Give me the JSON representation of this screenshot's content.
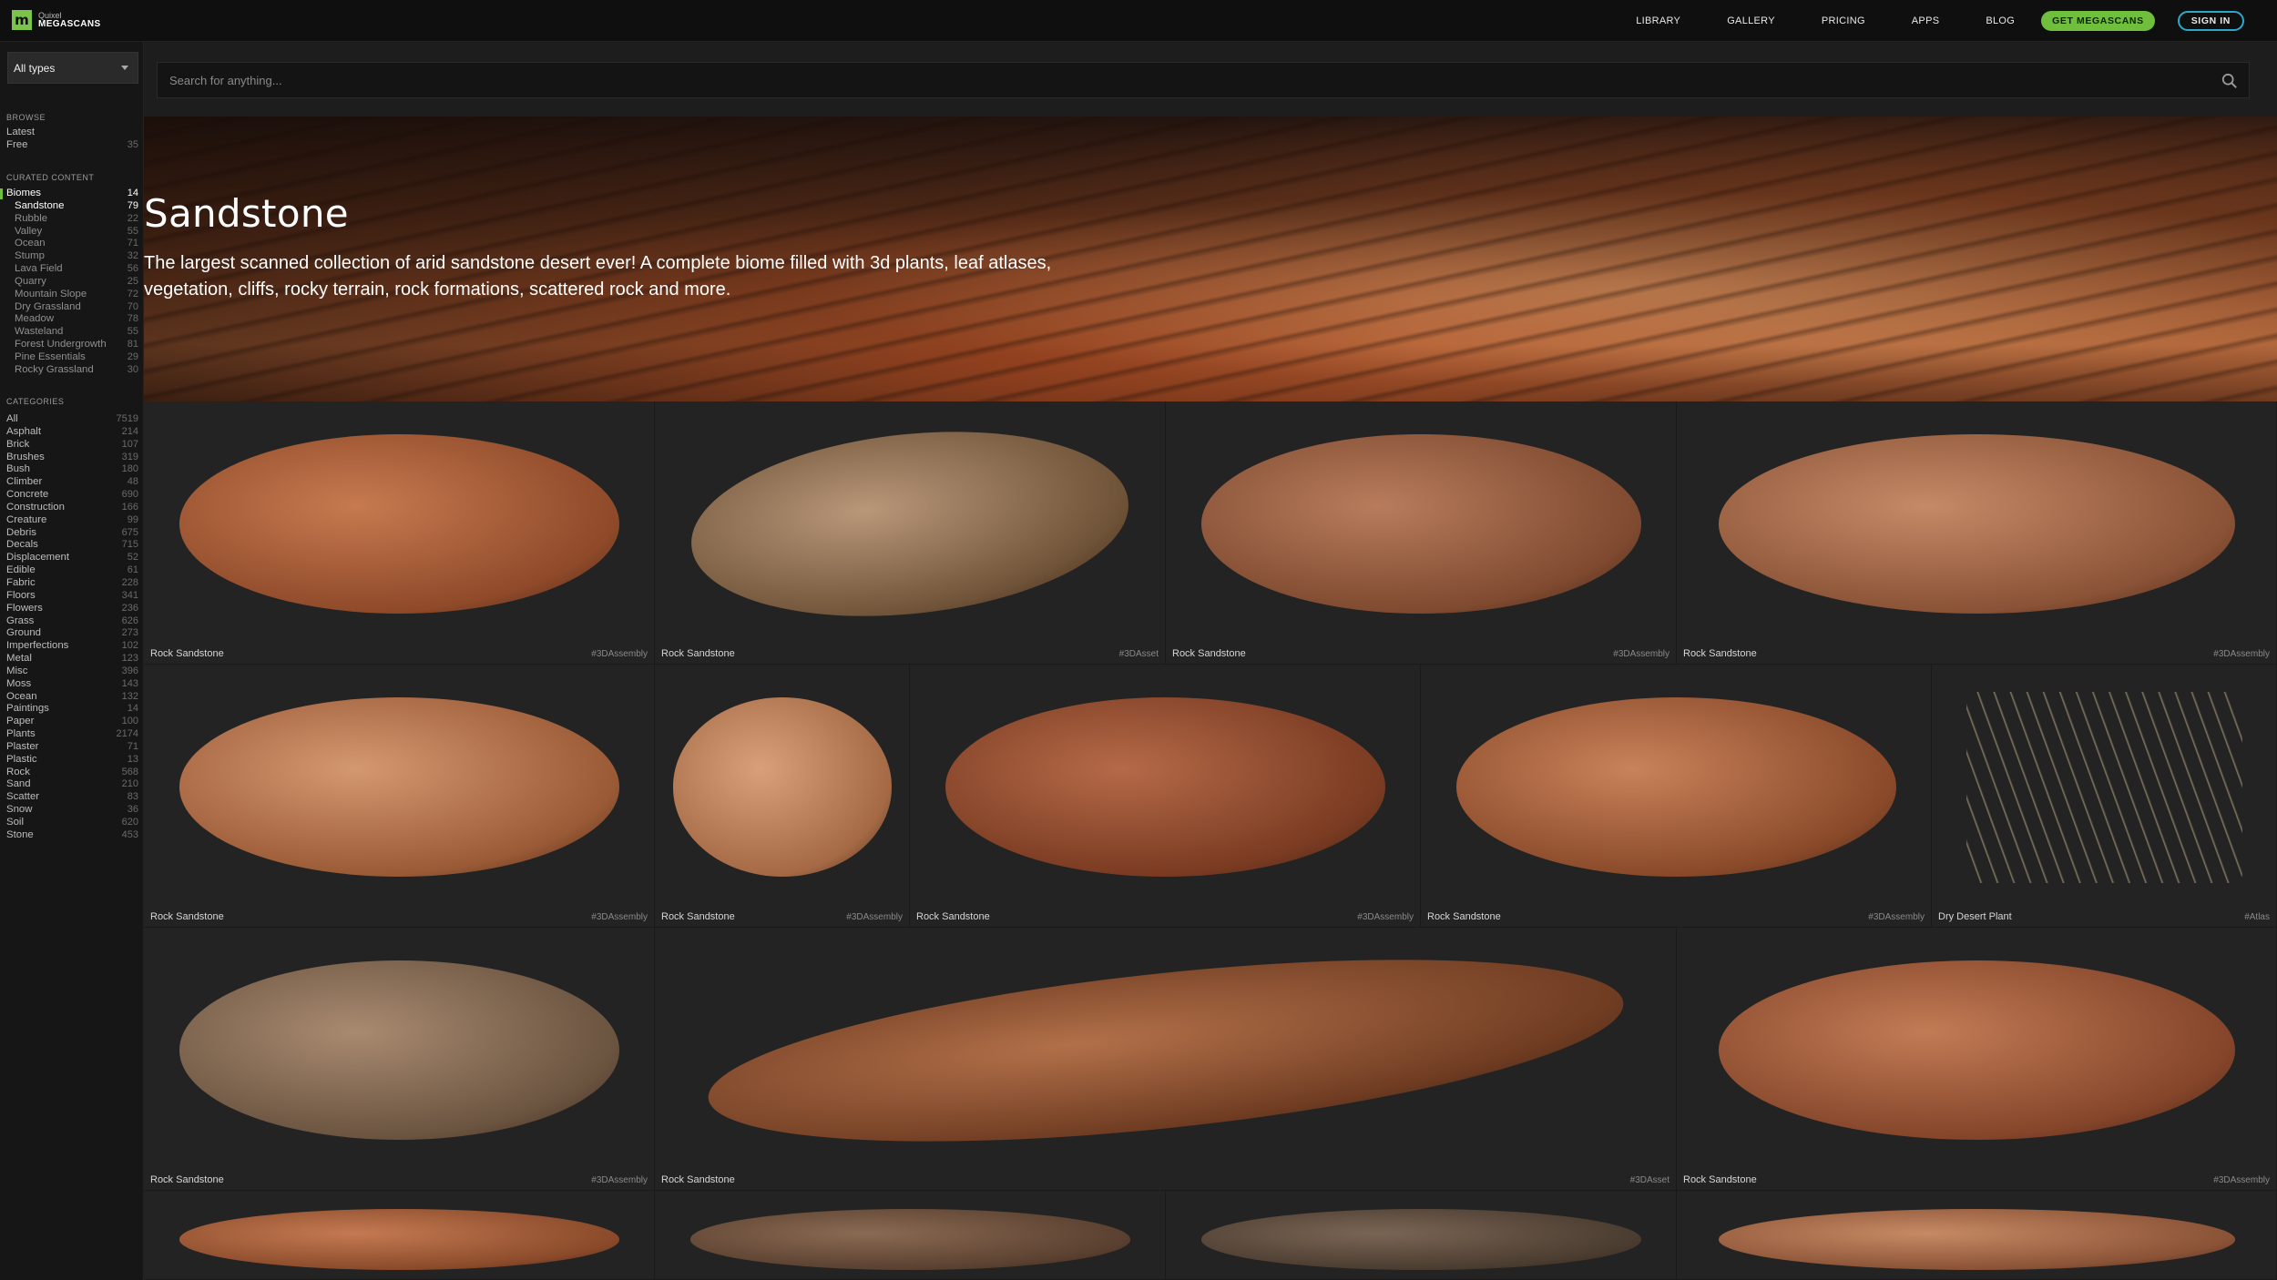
{
  "brand": {
    "mark": "m",
    "line1": "Quixel",
    "line2": "MEGASCANS"
  },
  "nav": {
    "links": [
      "LIBRARY",
      "GALLERY",
      "PRICING",
      "APPS",
      "BLOG"
    ],
    "get_label": "GET MEGASCANS",
    "sign_label": "SIGN IN",
    "accent": "#6fbf3c",
    "sign_border": "#2ca8c9"
  },
  "sidebar": {
    "type_select": "All types",
    "browse_title": "BROWSE",
    "browse": [
      {
        "label": "Latest",
        "count": ""
      },
      {
        "label": "Free",
        "count": "35"
      }
    ],
    "curated_title": "CURATED CONTENT",
    "curated": [
      {
        "label": "Biomes",
        "count": "14",
        "level": "parent-active"
      },
      {
        "label": "Sandstone",
        "count": "79",
        "level": "sub-active"
      },
      {
        "label": "Rubble",
        "count": "22",
        "level": "sub"
      },
      {
        "label": "Valley",
        "count": "55",
        "level": "sub"
      },
      {
        "label": "Ocean",
        "count": "71",
        "level": "sub"
      },
      {
        "label": "Stump",
        "count": "32",
        "level": "sub"
      },
      {
        "label": "Lava Field",
        "count": "56",
        "level": "sub"
      },
      {
        "label": "Quarry",
        "count": "25",
        "level": "sub"
      },
      {
        "label": "Mountain Slope",
        "count": "72",
        "level": "sub"
      },
      {
        "label": "Dry Grassland",
        "count": "70",
        "level": "sub"
      },
      {
        "label": "Meadow",
        "count": "78",
        "level": "sub"
      },
      {
        "label": "Wasteland",
        "count": "55",
        "level": "sub"
      },
      {
        "label": "Forest Undergrowth",
        "count": "81",
        "level": "sub"
      },
      {
        "label": "Pine Essentials",
        "count": "29",
        "level": "sub"
      },
      {
        "label": "Rocky Grassland",
        "count": "30",
        "level": "sub"
      }
    ],
    "categories_title": "CATEGORIES",
    "categories": [
      {
        "label": "All",
        "count": "7519"
      },
      {
        "label": "Asphalt",
        "count": "214"
      },
      {
        "label": "Brick",
        "count": "107"
      },
      {
        "label": "Brushes",
        "count": "319"
      },
      {
        "label": "Bush",
        "count": "180"
      },
      {
        "label": "Climber",
        "count": "48"
      },
      {
        "label": "Concrete",
        "count": "690"
      },
      {
        "label": "Construction",
        "count": "166"
      },
      {
        "label": "Creature",
        "count": "99"
      },
      {
        "label": "Debris",
        "count": "675"
      },
      {
        "label": "Decals",
        "count": "715"
      },
      {
        "label": "Displacement",
        "count": "52"
      },
      {
        "label": "Edible",
        "count": "61"
      },
      {
        "label": "Fabric",
        "count": "228"
      },
      {
        "label": "Floors",
        "count": "341"
      },
      {
        "label": "Flowers",
        "count": "236"
      },
      {
        "label": "Grass",
        "count": "626"
      },
      {
        "label": "Ground",
        "count": "273"
      },
      {
        "label": "Imperfections",
        "count": "102"
      },
      {
        "label": "Metal",
        "count": "123"
      },
      {
        "label": "Misc",
        "count": "396"
      },
      {
        "label": "Moss",
        "count": "143"
      },
      {
        "label": "Ocean",
        "count": "132"
      },
      {
        "label": "Paintings",
        "count": "14"
      },
      {
        "label": "Paper",
        "count": "100"
      },
      {
        "label": "Plants",
        "count": "2174"
      },
      {
        "label": "Plaster",
        "count": "71"
      },
      {
        "label": "Plastic",
        "count": "13"
      },
      {
        "label": "Rock",
        "count": "568"
      },
      {
        "label": "Sand",
        "count": "210"
      },
      {
        "label": "Scatter",
        "count": "83"
      },
      {
        "label": "Snow",
        "count": "36"
      },
      {
        "label": "Soil",
        "count": "620"
      },
      {
        "label": "Stone",
        "count": "453"
      }
    ]
  },
  "search": {
    "placeholder": "Search for anything..."
  },
  "hero": {
    "title": "Sandstone",
    "description": "The largest scanned collection of arid sandstone desert ever! A complete biome filled with 3d plants, leaf atlases, vegetation, cliffs, rocky terrain, rock formations, scattered rock and more."
  },
  "assets": [
    {
      "name": "Rock Sandstone",
      "tag": "#3DAssembly",
      "row": 0
    },
    {
      "name": "Rock Sandstone",
      "tag": "#3DAsset",
      "row": 0
    },
    {
      "name": "Rock Sandstone",
      "tag": "#3DAssembly",
      "row": 0
    },
    {
      "name": "Rock Sandstone",
      "tag": "#3DAssembly",
      "row": 0
    },
    {
      "name": "Rock Sandstone",
      "tag": "#3DAssembly",
      "row": 1
    },
    {
      "name": "Rock Sandstone",
      "tag": "#3DAssembly",
      "row": 1
    },
    {
      "name": "Rock Sandstone",
      "tag": "#3DAssembly",
      "row": 1
    },
    {
      "name": "Rock Sandstone",
      "tag": "#3DAssembly",
      "row": 1
    },
    {
      "name": "Dry Desert Plant",
      "tag": "#Atlas",
      "row": 1
    },
    {
      "name": "Rock Sandstone",
      "tag": "#3DAssembly",
      "row": 2
    },
    {
      "name": "Rock Sandstone",
      "tag": "#3DAsset",
      "row": 2
    },
    {
      "name": "Rock Sandstone",
      "tag": "#3DAssembly",
      "row": 2
    },
    {
      "name": "",
      "tag": "",
      "row": 3
    },
    {
      "name": "",
      "tag": "",
      "row": 3
    },
    {
      "name": "",
      "tag": "",
      "row": 3
    },
    {
      "name": "",
      "tag": "",
      "row": 3
    }
  ]
}
